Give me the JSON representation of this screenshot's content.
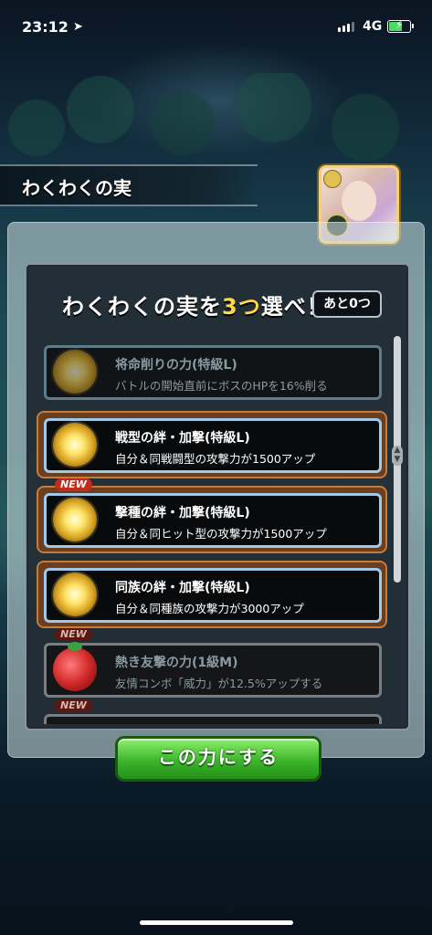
{
  "status_bar": {
    "time": "23:12",
    "location_icon": "location-arrow-icon",
    "network": "4G",
    "battery_level": 0.6
  },
  "screen": {
    "title": "わくわくの実"
  },
  "panel": {
    "headline_before": "わくわくの実を",
    "headline_highlight": "3つ",
    "headline_after": "選べ！",
    "remaining": "あと0つ"
  },
  "items": [
    {
      "name": "将命削りの力(特級L)",
      "desc": "バトルの開始直前にボスのHPを16%削る",
      "state": "dim",
      "new": false,
      "icon": "gold-orb-icon"
    },
    {
      "name": "戦型の絆・加撃(特級L)",
      "desc": "自分＆同戦闘型の攻撃力が1500アップ",
      "state": "selected",
      "new": false,
      "icon": "gold-orb-icon"
    },
    {
      "name": "撃種の絆・加撃(特級L)",
      "desc": "自分＆同ヒット型の攻撃力が1500アップ",
      "state": "selected",
      "new": true,
      "new_label": "NEW",
      "icon": "gold-orb-icon"
    },
    {
      "name": "同族の絆・加撃(特級L)",
      "desc": "自分＆同種族の攻撃力が3000アップ",
      "state": "selected",
      "new": false,
      "icon": "gold-orb-icon"
    },
    {
      "name": "熱き友撃の力(1級M)",
      "desc": "友情コンボ「威力」が12.5%アップする",
      "state": "gray",
      "new": true,
      "new_label": "NEW",
      "icon": "red-fruit-icon"
    },
    {
      "name": "",
      "desc": "",
      "state": "gray",
      "new": true,
      "new_label": "NEW",
      "icon": ""
    }
  ],
  "confirm_button": {
    "label": "この力にする"
  }
}
